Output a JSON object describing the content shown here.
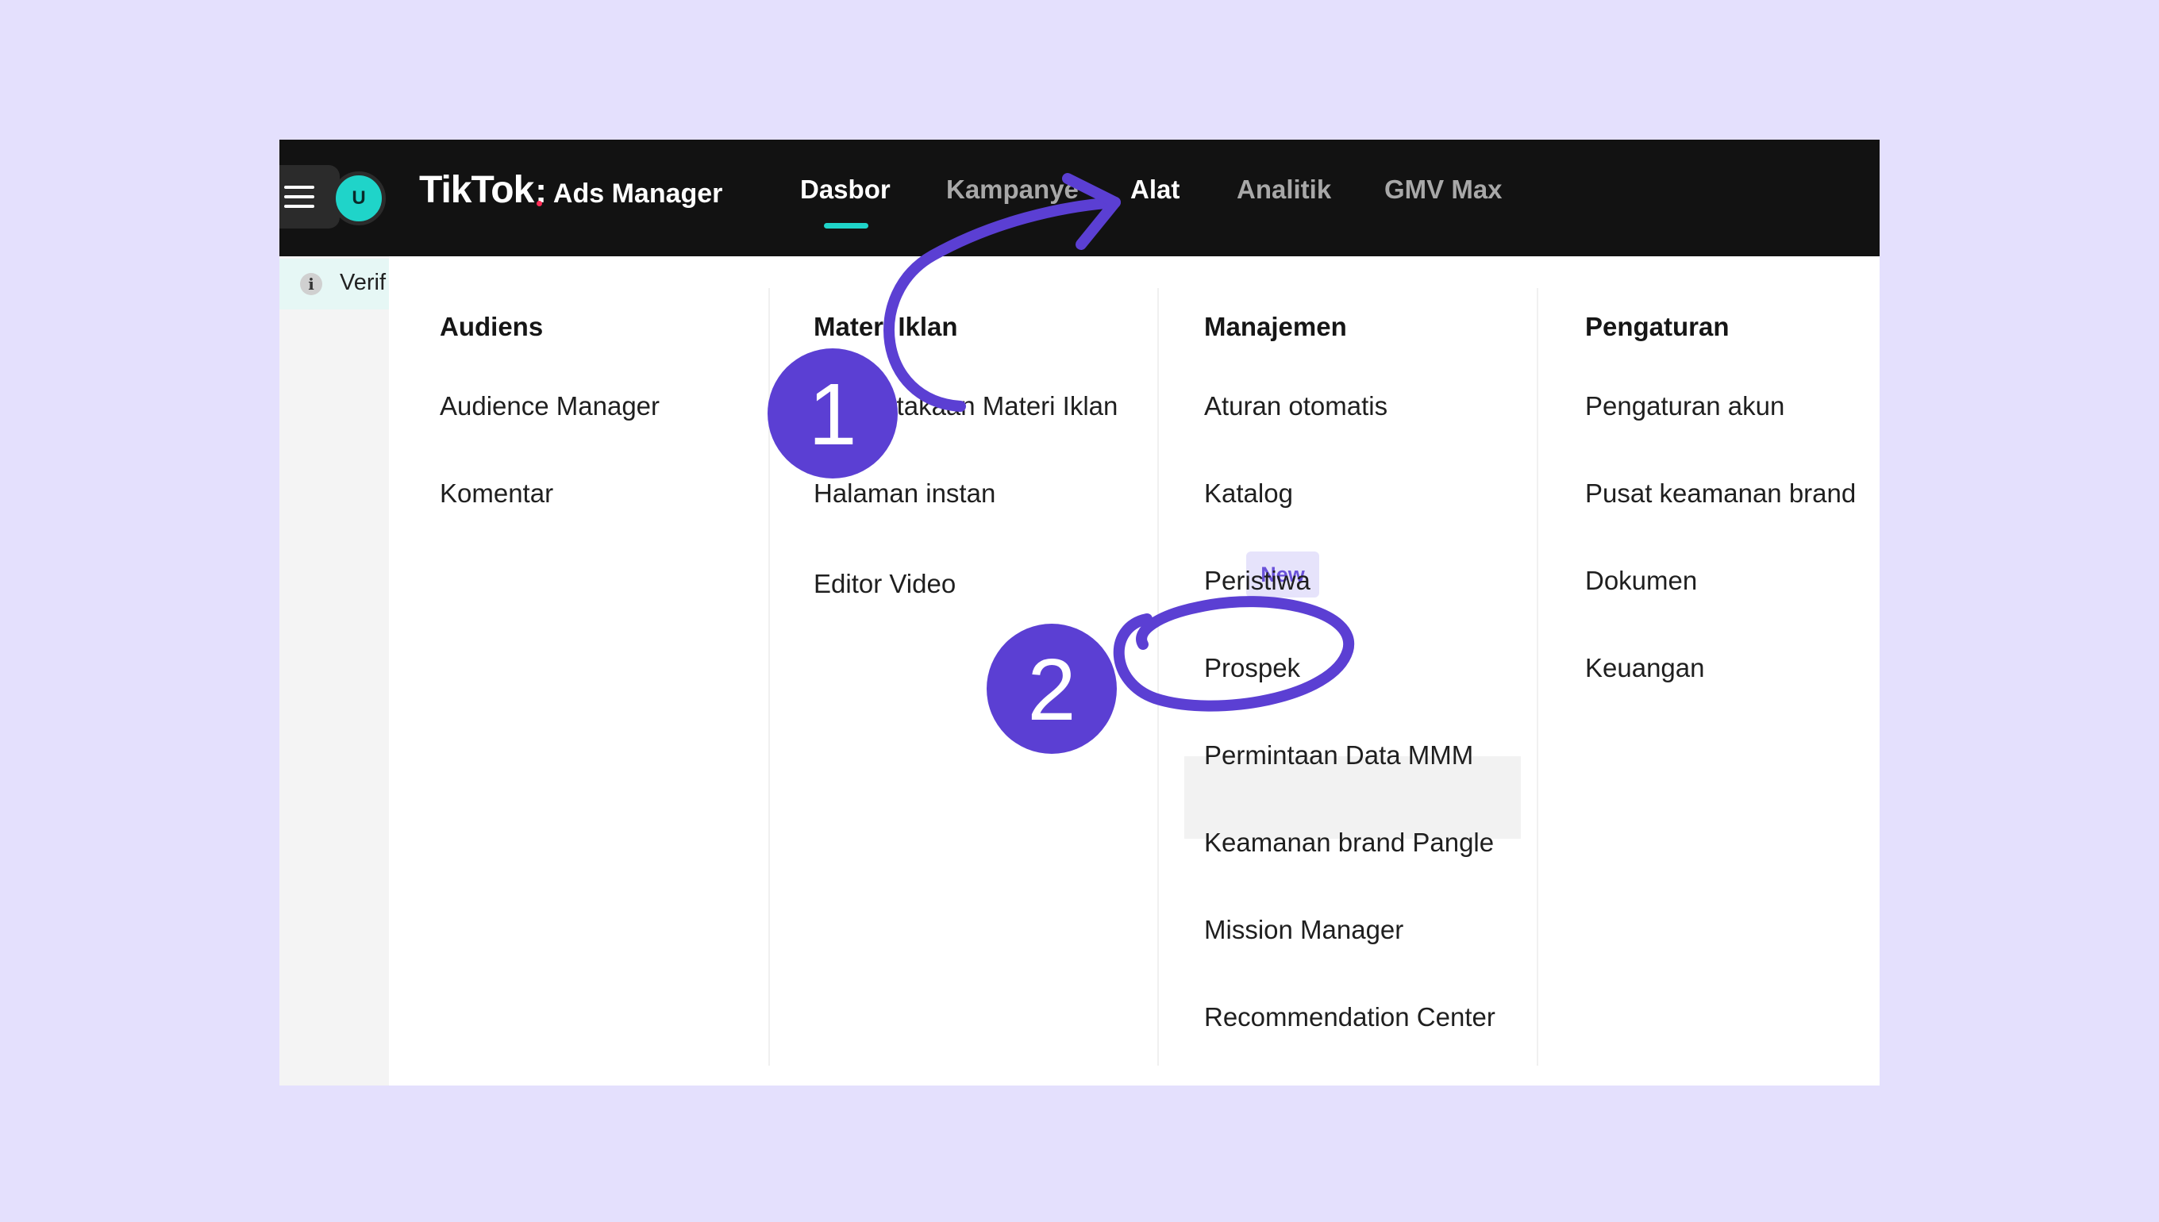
{
  "topbar": {
    "avatar_letter": "U",
    "brand_name": "TikTok",
    "brand_colon": ":",
    "brand_product": "Ads Manager",
    "nav": [
      {
        "label": "Dasbor",
        "state": "active"
      },
      {
        "label": "Kampanye",
        "state": "normal"
      },
      {
        "label": "Alat",
        "state": "hover"
      },
      {
        "label": "Analitik",
        "state": "normal"
      },
      {
        "label": "GMV Max",
        "state": "normal"
      }
    ],
    "accent_color": "#1fd4c9"
  },
  "banner": {
    "icon": "info-icon",
    "icon_glyph": "i",
    "text": "Verif"
  },
  "menu": {
    "columns": [
      {
        "heading": "Audiens",
        "items": [
          "Audience Manager",
          "Komentar"
        ]
      },
      {
        "heading": "Materi Iklan",
        "items": [
          "Perpustakaan Materi Iklan",
          "Halaman instan",
          "Editor Video"
        ],
        "badge": "New"
      },
      {
        "heading": "Manajemen",
        "items": [
          "Aturan otomatis",
          "Katalog",
          "Peristiwa",
          "Prospek",
          "Permintaan Data MMM",
          "Keamanan brand Pangle",
          "Mission Manager",
          "Recommendation Center"
        ],
        "highlighted": "Prospek"
      },
      {
        "heading": "Pengaturan",
        "items": [
          "Pengaturan akun",
          "Pusat keamanan brand",
          "Dokumen",
          "Keuangan"
        ]
      }
    ]
  },
  "annotations": {
    "color": "#5b3fd3",
    "steps": [
      "1",
      "2"
    ]
  }
}
